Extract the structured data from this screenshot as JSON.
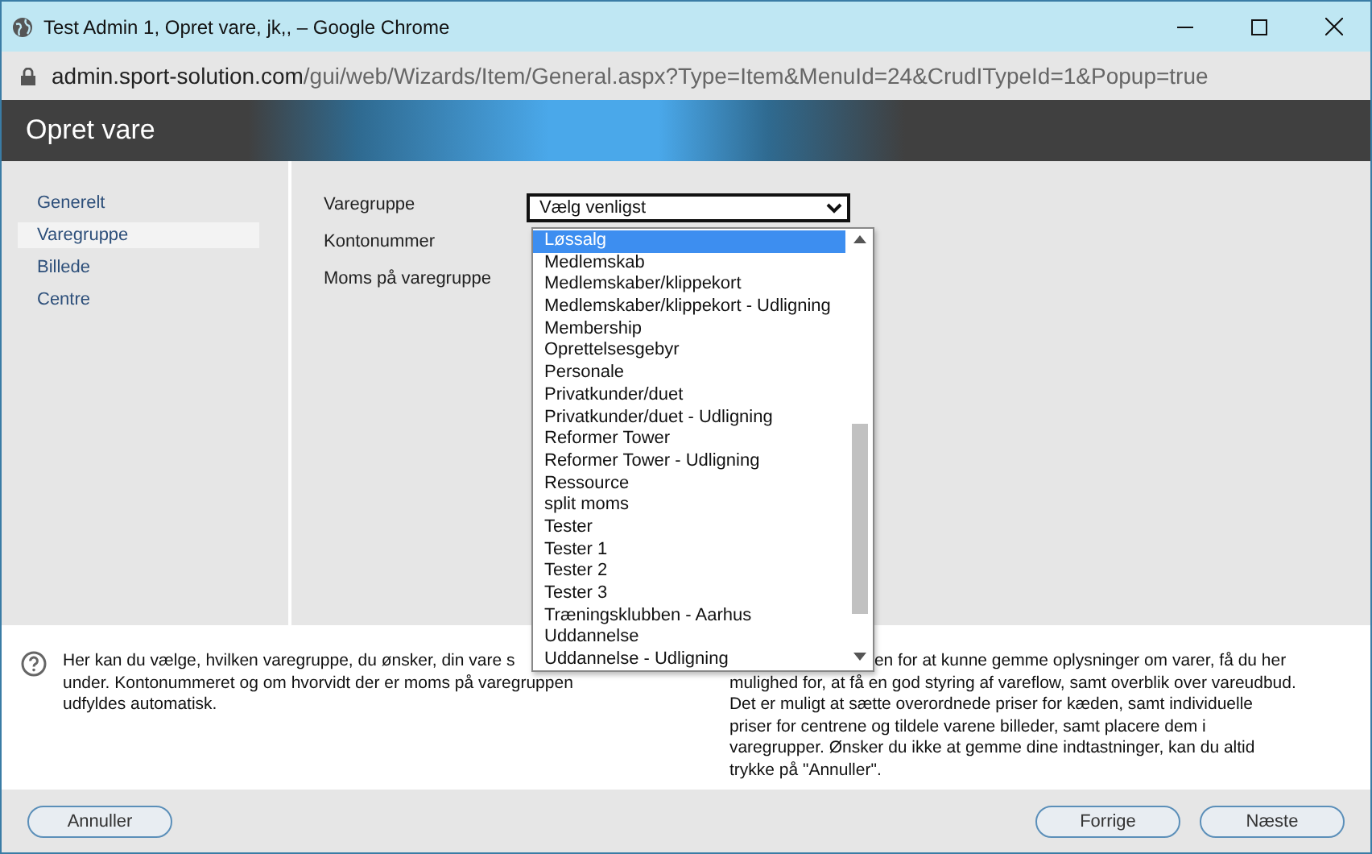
{
  "window": {
    "title": "Test Admin 1, Opret vare, jk,, – Google Chrome"
  },
  "address_bar": {
    "url_host": "admin.sport-solution.com",
    "url_path": "/gui/web/Wizards/Item/General.aspx?Type=Item&MenuId=24&CrudITypeId=1&Popup=true"
  },
  "header": {
    "title": "Opret vare"
  },
  "sidebar": {
    "items": [
      {
        "label": "Generelt",
        "selected": false
      },
      {
        "label": "Varegruppe",
        "selected": true
      },
      {
        "label": "Billede",
        "selected": false
      },
      {
        "label": "Centre",
        "selected": false
      }
    ]
  },
  "form": {
    "fields": [
      {
        "label": "Varegruppe"
      },
      {
        "label": "Kontonummer"
      },
      {
        "label": "Moms på varegruppe"
      }
    ],
    "select": {
      "value": "Vælg venligst",
      "expanded": true,
      "options": [
        {
          "label": "Løssalg",
          "selected": true
        },
        {
          "label": "Medlemskab",
          "selected": false
        },
        {
          "label": "Medlemskaber/klippekort",
          "selected": false
        },
        {
          "label": "Medlemskaber/klippekort - Udligning",
          "selected": false
        },
        {
          "label": "Membership",
          "selected": false
        },
        {
          "label": "Oprettelsesgebyr",
          "selected": false
        },
        {
          "label": "Personale",
          "selected": false
        },
        {
          "label": "Privatkunder/duet",
          "selected": false
        },
        {
          "label": "Privatkunder/duet - Udligning",
          "selected": false
        },
        {
          "label": "Reformer Tower",
          "selected": false
        },
        {
          "label": "Reformer Tower - Udligning",
          "selected": false
        },
        {
          "label": "Ressource",
          "selected": false
        },
        {
          "label": "split moms",
          "selected": false
        },
        {
          "label": "Tester",
          "selected": false
        },
        {
          "label": "Tester 1",
          "selected": false
        },
        {
          "label": "Tester 2",
          "selected": false
        },
        {
          "label": "Tester 3",
          "selected": false
        },
        {
          "label": "Træningsklubben - Aarhus",
          "selected": false
        },
        {
          "label": "Uddannelse",
          "selected": false
        },
        {
          "label": "Uddannelse - Udligning",
          "selected": false
        }
      ]
    }
  },
  "help": {
    "left_lines": [
      "Her kan du vælge, hvilken varegruppe, du ønsker, din vare s",
      "under. Kontonummeret og om hvorvidt der er moms på varegruppen",
      "udfyldes automatisk."
    ],
    "right_lines": [
      "en for at kunne gemme oplysninger om varer, få du her",
      "mulighed for, at få en god styring af vareflow, samt overblik over vareudbud.",
      "Det er muligt at sætte overordnede priser for kæden, samt individuelle",
      "priser for centrene og tildele varene billeder, samt placere dem i",
      "varegrupper. Ønsker du ikke at gemme dine indtastninger, kan du altid",
      "trykke på \"Annuller\"."
    ]
  },
  "footer": {
    "left_buttons": [
      "Annuller"
    ],
    "right_buttons": [
      "Forrige",
      "Næste"
    ]
  }
}
